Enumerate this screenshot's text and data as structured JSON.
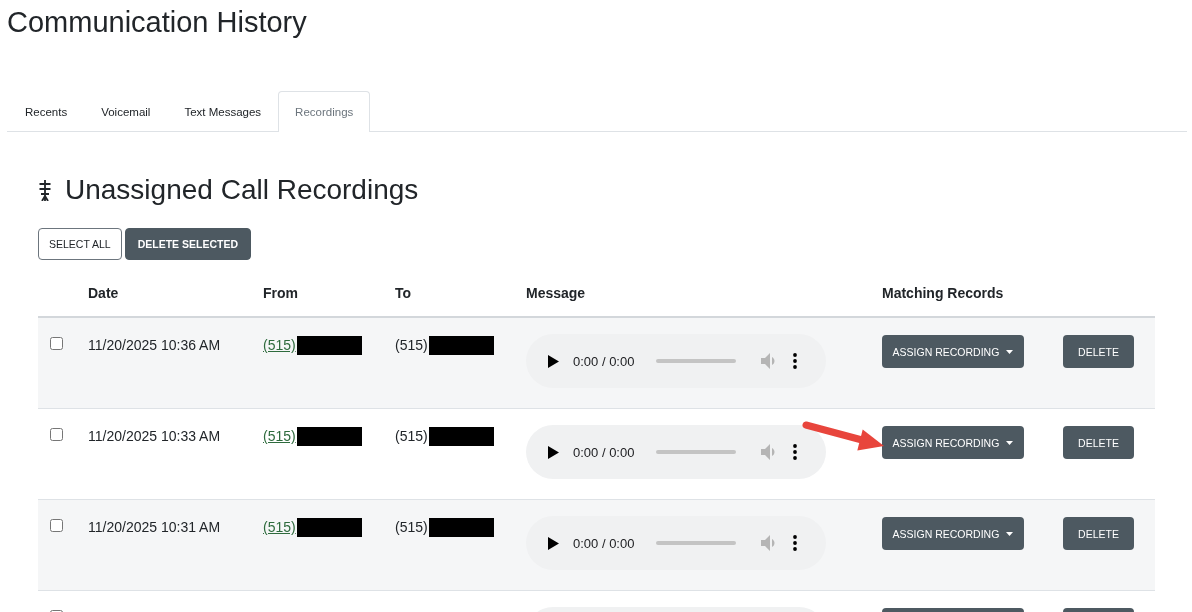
{
  "page_title": "Communication History",
  "tabs": [
    {
      "label": "Recents",
      "selected": false
    },
    {
      "label": "Voicemail",
      "selected": false
    },
    {
      "label": "Text Messages",
      "selected": false
    },
    {
      "label": "Recordings",
      "selected": true
    }
  ],
  "section": {
    "title": "Unassigned Call Recordings",
    "actions": [
      {
        "label": "SELECT ALL",
        "kind": "outline"
      },
      {
        "label": "DELETE SELECTED",
        "kind": "solid"
      }
    ],
    "table": {
      "columns": [
        "Date",
        "From",
        "To",
        "Message",
        "Matching Records"
      ],
      "rows": [
        {
          "checked": false,
          "date": "11/20/2025 10:36 AM",
          "from": {
            "text": "(515)",
            "redacted": true
          },
          "to": {
            "text": "(515)",
            "redacted": true
          },
          "message": {
            "time": "0:00 / 0:00"
          },
          "assign_label": "ASSIGN RECORDING",
          "delete_label": "DELETE",
          "arrow": false
        },
        {
          "checked": false,
          "date": "11/20/2025 10:33 AM",
          "from": {
            "text": "(515)",
            "redacted": true
          },
          "to": {
            "text": "(515)",
            "redacted": true
          },
          "message": {
            "time": "0:00 / 0:00"
          },
          "assign_label": "ASSIGN RECORDING",
          "delete_label": "DELETE",
          "arrow": true
        },
        {
          "checked": false,
          "date": "11/20/2025 10:31 AM",
          "from": {
            "text": "(515)",
            "redacted": true
          },
          "to": {
            "text": "(515)",
            "redacted": true
          },
          "message": {
            "time": "0:00 / 0:00"
          },
          "assign_label": "ASSIGN RECORDING",
          "delete_label": "DELETE",
          "arrow": false
        },
        {
          "checked": false,
          "arrow": false
        }
      ]
    }
  }
}
